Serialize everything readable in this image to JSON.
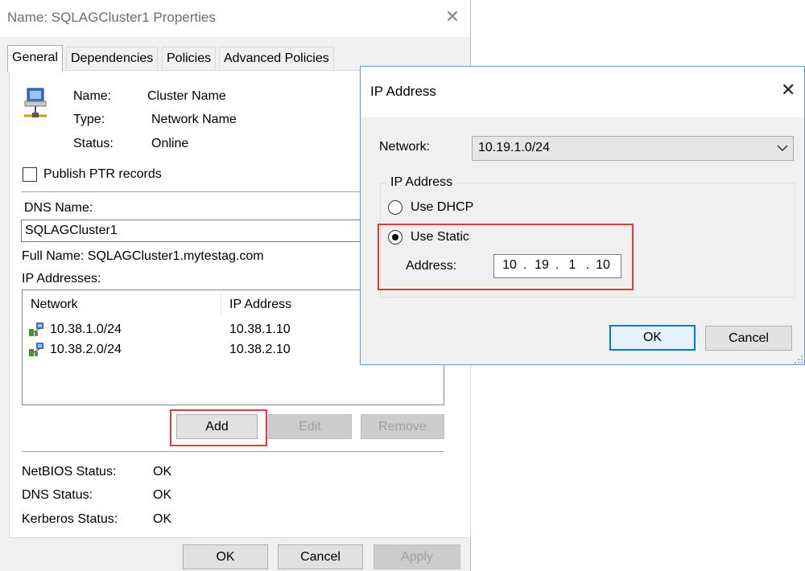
{
  "properties": {
    "title": "Name: SQLAGCluster1 Properties",
    "close_glyph": "✕",
    "tabs": [
      "General",
      "Dependencies",
      "Policies",
      "Advanced Policies"
    ],
    "info": {
      "name_label": "Name:",
      "name_value": "Cluster Name",
      "type_label": "Type:",
      "type_value": "Network Name",
      "status_label": "Status:",
      "status_value": "Online"
    },
    "publish_ptr_label": "Publish PTR records",
    "dns_name_label": "DNS Name:",
    "dns_name_value": "SQLAGCluster1",
    "full_name": "Full Name: SQLAGCluster1.mytestag.com",
    "ip_addresses_label": "IP Addresses:",
    "ip_table": {
      "headers": [
        "Network",
        "IP Address"
      ],
      "rows": [
        {
          "network": "10.38.1.0/24",
          "ip": "10.38.1.10"
        },
        {
          "network": "10.38.2.0/24",
          "ip": "10.38.2.10"
        }
      ]
    },
    "buttons": {
      "add": "Add",
      "edit": "Edit",
      "remove": "Remove"
    },
    "statuses": {
      "netbios_label": "NetBIOS Status:",
      "netbios_value": "OK",
      "dns_label": "DNS Status:",
      "dns_value": "OK",
      "kerberos_label": "Kerberos Status:",
      "kerberos_value": "OK"
    },
    "footer": {
      "ok": "OK",
      "cancel": "Cancel",
      "apply": "Apply"
    }
  },
  "ip_dialog": {
    "title": "IP Address",
    "close_glyph": "✕",
    "network_label": "Network:",
    "network_value": "10.19.1.0/24",
    "group_label": "IP Address",
    "dhcp_label": "Use DHCP",
    "static_label": "Use Static",
    "address_label": "Address:",
    "address_octets": [
      "10",
      "19",
      "1",
      "10"
    ],
    "ok": "OK",
    "cancel": "Cancel"
  },
  "colors": {
    "highlight": "#e03c3c",
    "focus_blue": "#0078d7",
    "dialog_border": "#5b9bd5"
  }
}
